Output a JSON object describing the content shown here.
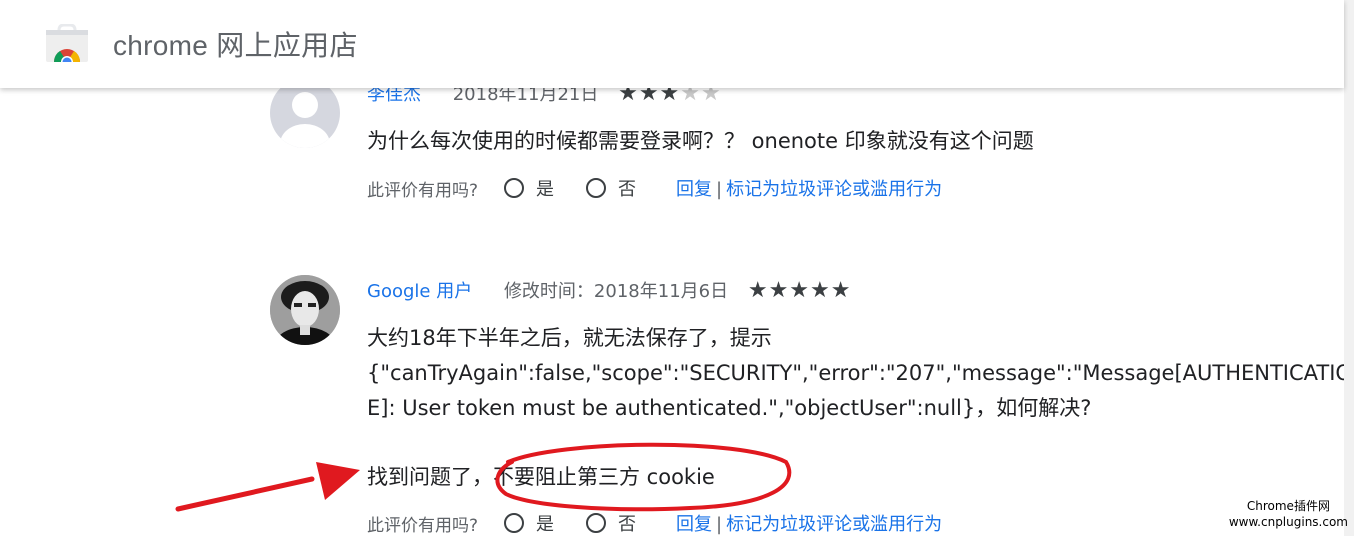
{
  "header": {
    "title": "chrome 网上应用店",
    "logo_icon": "chrome-web-store-icon"
  },
  "reviews": [
    {
      "author": "李佳杰",
      "date": "2018年11月21日",
      "rating": 3,
      "text_lines": [
        "为什么每次使用的时候都需要登录啊？？ onenote 印象就没有这个问题"
      ],
      "helpful_label": "此评价有用吗?",
      "yes_label": "是",
      "no_label": "否",
      "reply_label": "回复",
      "separator": "|",
      "report_label": "标记为垃圾评论或滥用行为"
    },
    {
      "author": "Google 用户",
      "date": "修改时间：2018年11月6日",
      "rating": 5,
      "text_lines": [
        "大约18年下半年之后，就无法保存了，提示",
        "{\"canTryAgain\":false,\"scope\":\"SECURITY\",\"error\":\"207\",\"message\":\"Message[AUTHENTICATIO",
        "E]: User token must be authenticated.\",\"objectUser\":null}，如何解决?"
      ],
      "reply_text": "找到问题了，不要阻止第三方 cookie",
      "helpful_label": "此评价有用吗?",
      "yes_label": "是",
      "no_label": "否",
      "reply_label": "回复",
      "separator": "|",
      "report_label": "标记为垃圾评论或滥用行为"
    }
  ],
  "annotation": {
    "color": "#e0191f"
  },
  "watermark": {
    "line1": "Chrome插件网",
    "line2": "www.cnplugins.com"
  }
}
